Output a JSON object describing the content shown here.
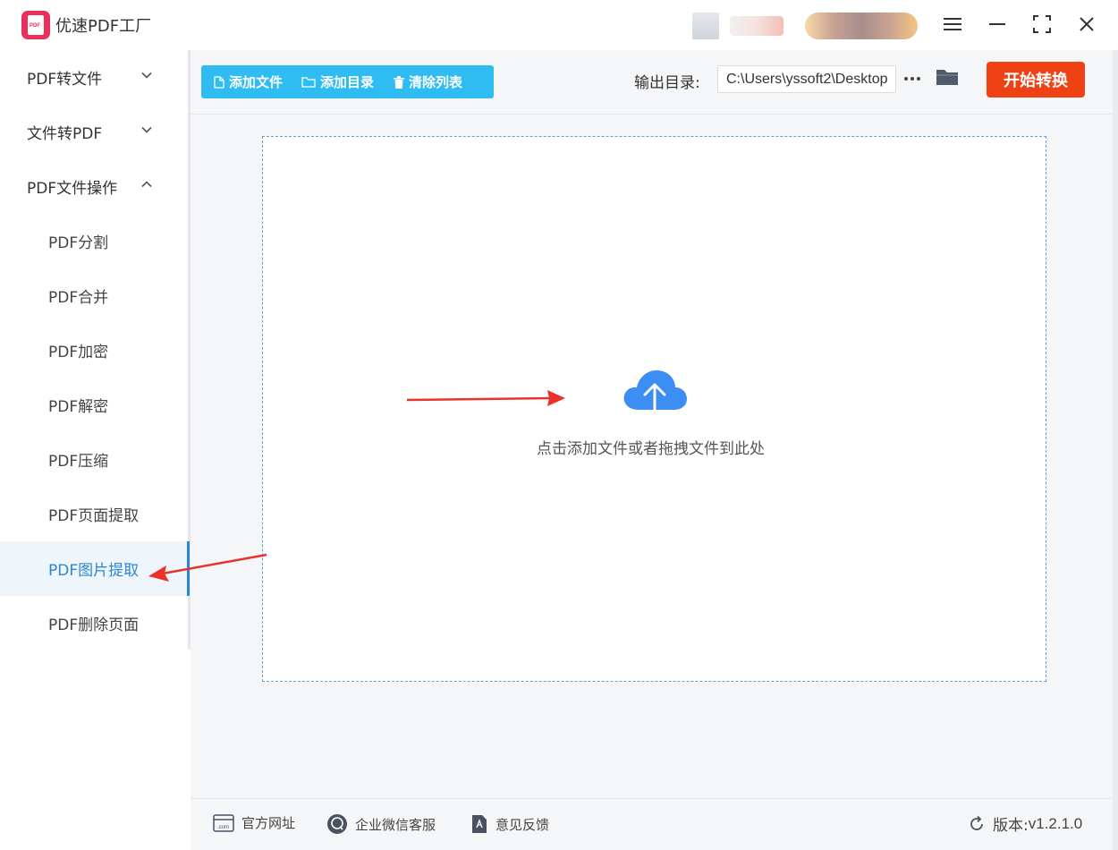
{
  "window": {
    "title": "优速PDF工厂",
    "logo_text": "PDF"
  },
  "sidebar": {
    "groups": [
      {
        "label": "PDF转文件",
        "expanded": false
      },
      {
        "label": "文件转PDF",
        "expanded": false
      },
      {
        "label": "PDF文件操作",
        "expanded": true
      }
    ],
    "items": [
      {
        "label": "PDF分割"
      },
      {
        "label": "PDF合并"
      },
      {
        "label": "PDF加密"
      },
      {
        "label": "PDF解密"
      },
      {
        "label": "PDF压缩"
      },
      {
        "label": "PDF页面提取"
      },
      {
        "label": "PDF图片提取",
        "active": true
      },
      {
        "label": "PDF删除页面"
      }
    ]
  },
  "toolbar": {
    "add_file": "添加文件",
    "add_dir": "添加目录",
    "clear_list": "清除列表",
    "output_label": "输出目录:",
    "output_path": "C:\\Users\\yssoft2\\Desktop",
    "more": "···",
    "start": "开始转换"
  },
  "dropzone": {
    "text": "点击添加文件或者拖拽文件到此处"
  },
  "footer": {
    "website": "官方网址",
    "wechat": "企业微信客服",
    "feedback": "意见反馈",
    "version_label": "版本:",
    "version": "v1.2.1.0"
  },
  "colors": {
    "accent_blue": "#2ebcf3",
    "active_blue": "#2c86d4",
    "start_red": "#ee4214",
    "arrow_red": "#e8322a"
  }
}
